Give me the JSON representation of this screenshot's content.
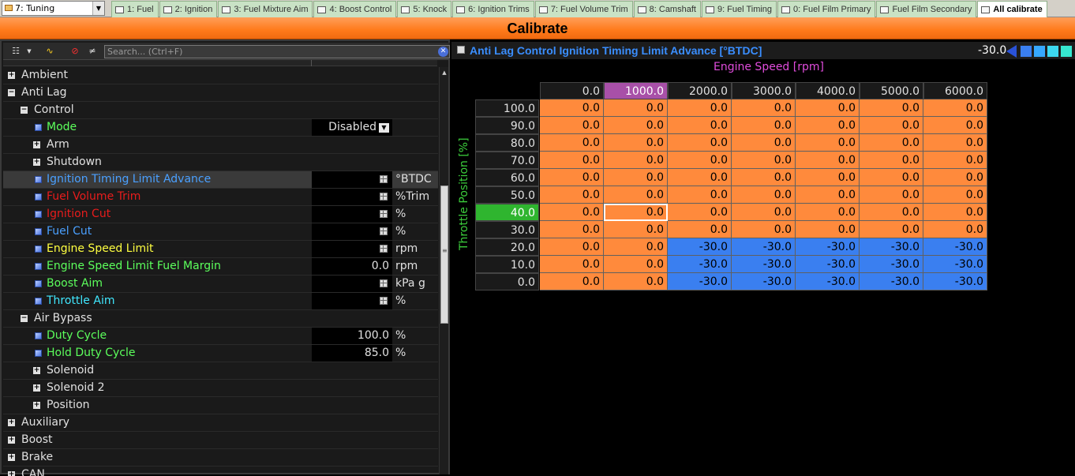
{
  "workspace": {
    "selected": "7: Tuning"
  },
  "tabs": [
    {
      "label": "1: Fuel",
      "active": false
    },
    {
      "label": "2: Ignition",
      "active": false
    },
    {
      "label": "3: Fuel Mixture Aim",
      "active": false
    },
    {
      "label": "4: Boost Control",
      "active": false
    },
    {
      "label": "5: Knock",
      "active": false
    },
    {
      "label": "6: Ignition Trims",
      "active": false
    },
    {
      "label": "7: Fuel Volume Trim",
      "active": false
    },
    {
      "label": "8: Camshaft",
      "active": false
    },
    {
      "label": "9: Fuel Timing",
      "active": false
    },
    {
      "label": "0: Fuel Film Primary",
      "active": false
    },
    {
      "label": "Fuel Film Secondary",
      "active": false
    },
    {
      "label": "All calibrate",
      "active": true
    }
  ],
  "title": "Calibrate",
  "search": {
    "placeholder": "Search... (Ctrl+F)"
  },
  "tree": [
    {
      "label": "Ambient",
      "type": "group",
      "indent": 0,
      "state": "collapsed",
      "color": "#e0e0e0"
    },
    {
      "label": "Anti Lag",
      "type": "group",
      "indent": 0,
      "state": "expanded",
      "color": "#e0e0e0"
    },
    {
      "label": "Control",
      "type": "group",
      "indent": 1,
      "state": "expanded",
      "color": "#e0e0e0"
    },
    {
      "label": "Mode",
      "type": "item",
      "indent": 2,
      "color": "#5cff5c",
      "value": "Disabled",
      "dropdown": true,
      "unit": ""
    },
    {
      "label": "Arm",
      "type": "group",
      "indent": 2,
      "state": "collapsed",
      "color": "#e0e0e0"
    },
    {
      "label": "Shutdown",
      "type": "group",
      "indent": 2,
      "state": "collapsed",
      "color": "#e0e0e0"
    },
    {
      "label": "Ignition Timing Limit Advance",
      "type": "item",
      "indent": 2,
      "color": "#4aa0ff",
      "table": true,
      "unit": "°BTDC",
      "selected": true
    },
    {
      "label": "Fuel Volume Trim",
      "type": "item",
      "indent": 2,
      "color": "#e81c1c",
      "table": true,
      "unit": "%Trim"
    },
    {
      "label": "Ignition Cut",
      "type": "item",
      "indent": 2,
      "color": "#e81c1c",
      "table": true,
      "unit": "%"
    },
    {
      "label": "Fuel Cut",
      "type": "item",
      "indent": 2,
      "color": "#4aa0ff",
      "table": true,
      "unit": "%"
    },
    {
      "label": "Engine Speed Limit",
      "type": "item",
      "indent": 2,
      "color": "#ffff40",
      "table": true,
      "unit": "rpm"
    },
    {
      "label": "Engine Speed Limit Fuel Margin",
      "type": "item",
      "indent": 2,
      "color": "#5cff5c",
      "value": "0.0",
      "unit": "rpm"
    },
    {
      "label": "Boost Aim",
      "type": "item",
      "indent": 2,
      "color": "#5cff5c",
      "table": true,
      "unit": "kPa g"
    },
    {
      "label": "Throttle Aim",
      "type": "item",
      "indent": 2,
      "color": "#40e8ff",
      "table": true,
      "unit": "%"
    },
    {
      "label": "Air Bypass",
      "type": "group",
      "indent": 1,
      "state": "expanded",
      "color": "#e0e0e0"
    },
    {
      "label": "Duty Cycle",
      "type": "item",
      "indent": 2,
      "color": "#5cff5c",
      "value": "100.0",
      "unit": "%"
    },
    {
      "label": "Hold Duty Cycle",
      "type": "item",
      "indent": 2,
      "color": "#5cff5c",
      "value": "85.0",
      "unit": "%"
    },
    {
      "label": "Solenoid",
      "type": "group",
      "indent": 2,
      "state": "collapsed",
      "color": "#e0e0e0"
    },
    {
      "label": "Solenoid 2",
      "type": "group",
      "indent": 2,
      "state": "collapsed",
      "color": "#e0e0e0"
    },
    {
      "label": "Position",
      "type": "group",
      "indent": 2,
      "state": "collapsed",
      "color": "#e0e0e0"
    },
    {
      "label": "Auxiliary",
      "type": "group",
      "indent": 0,
      "state": "collapsed",
      "color": "#e0e0e0"
    },
    {
      "label": "Boost",
      "type": "group",
      "indent": 0,
      "state": "collapsed",
      "color": "#e0e0e0"
    },
    {
      "label": "Brake",
      "type": "group",
      "indent": 0,
      "state": "collapsed",
      "color": "#e0e0e0"
    },
    {
      "label": "CAN",
      "type": "group",
      "indent": 0,
      "state": "collapsed",
      "color": "#e0e0e0"
    }
  ],
  "table": {
    "title": "Anti Lag Control Ignition Timing Limit Advance [°BTDC]",
    "current_value": "-30.0",
    "x_axis_label": "Engine Speed [rpm]",
    "y_axis_label": "Throttle Position [%]",
    "columns": [
      "0.0",
      "1000.0",
      "2000.0",
      "3000.0",
      "4000.0",
      "5000.0",
      "6000.0"
    ],
    "active_column": 1,
    "active_row": 6,
    "rows": [
      {
        "label": "100.0",
        "values": [
          "0.0",
          "0.0",
          "0.0",
          "0.0",
          "0.0",
          "0.0",
          "0.0"
        ]
      },
      {
        "label": "90.0",
        "values": [
          "0.0",
          "0.0",
          "0.0",
          "0.0",
          "0.0",
          "0.0",
          "0.0"
        ]
      },
      {
        "label": "80.0",
        "values": [
          "0.0",
          "0.0",
          "0.0",
          "0.0",
          "0.0",
          "0.0",
          "0.0"
        ]
      },
      {
        "label": "70.0",
        "values": [
          "0.0",
          "0.0",
          "0.0",
          "0.0",
          "0.0",
          "0.0",
          "0.0"
        ]
      },
      {
        "label": "60.0",
        "values": [
          "0.0",
          "0.0",
          "0.0",
          "0.0",
          "0.0",
          "0.0",
          "0.0"
        ]
      },
      {
        "label": "50.0",
        "values": [
          "0.0",
          "0.0",
          "0.0",
          "0.0",
          "0.0",
          "0.0",
          "0.0"
        ]
      },
      {
        "label": "40.0",
        "values": [
          "0.0",
          "0.0",
          "0.0",
          "0.0",
          "0.0",
          "0.0",
          "0.0"
        ]
      },
      {
        "label": "30.0",
        "values": [
          "0.0",
          "0.0",
          "0.0",
          "0.0",
          "0.0",
          "0.0",
          "0.0"
        ]
      },
      {
        "label": "20.0",
        "values": [
          "0.0",
          "0.0",
          "-30.0",
          "-30.0",
          "-30.0",
          "-30.0",
          "-30.0"
        ]
      },
      {
        "label": "10.0",
        "values": [
          "0.0",
          "0.0",
          "-30.0",
          "-30.0",
          "-30.0",
          "-30.0",
          "-30.0"
        ]
      },
      {
        "label": "0.0",
        "values": [
          "0.0",
          "0.0",
          "-30.0",
          "-30.0",
          "-30.0",
          "-30.0",
          "-30.0"
        ]
      }
    ],
    "colors": {
      "zero": "#ff8a3c",
      "negative": "#3a7ff0",
      "active_column": "#a850a8",
      "active_row": "#2fb52f"
    },
    "swatches": [
      "#3a7ff0",
      "#36a8ff",
      "#3cd8f0",
      "#36e8d0"
    ]
  }
}
